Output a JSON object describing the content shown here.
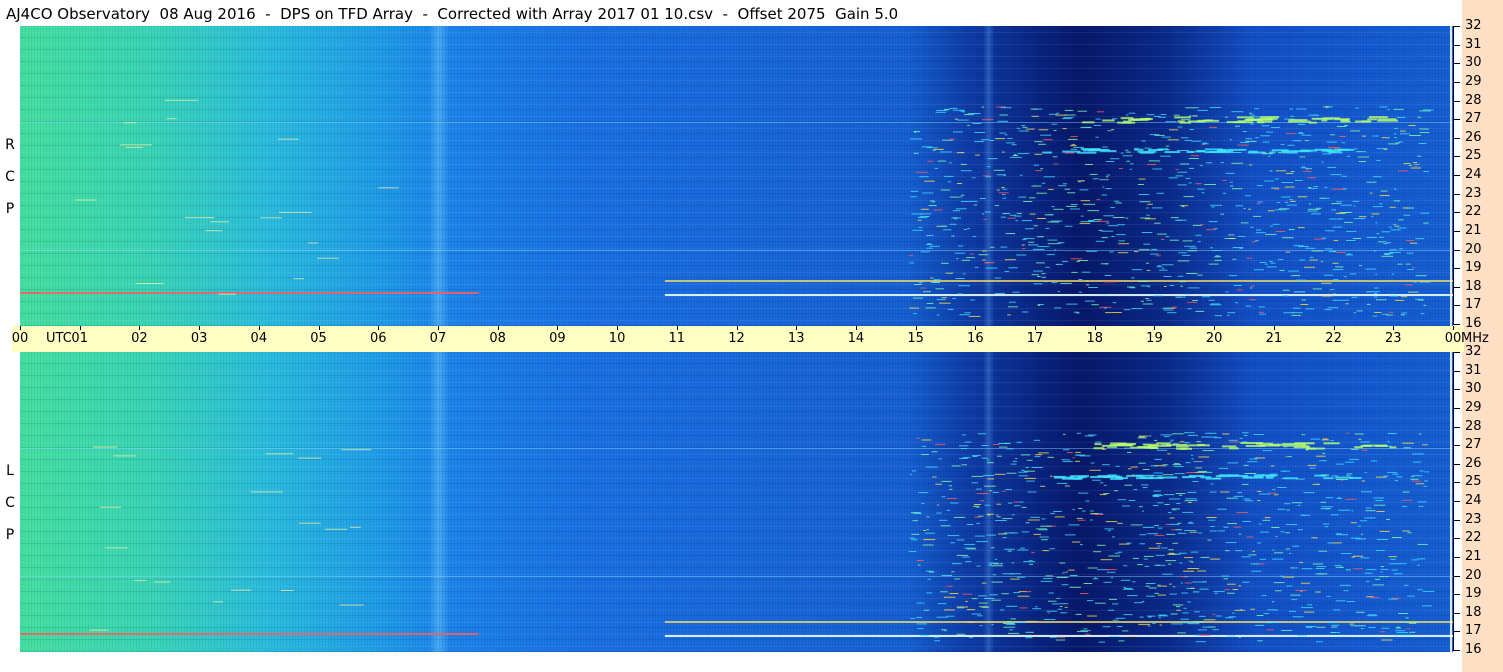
{
  "title": "AJ4CO Observatory  08 Aug 2016  -  DPS on TFD Array  -  Corrected with Array 2017 01 10.csv  -  Offset 2075  Gain 5.0",
  "panels": {
    "rcp": {
      "label": [
        "R",
        "C",
        "P"
      ]
    },
    "lcp": {
      "label": [
        "L",
        "C",
        "P"
      ]
    }
  },
  "time_axis": {
    "labels": [
      "00",
      "01",
      "02",
      "03",
      "04",
      "05",
      "06",
      "07",
      "08",
      "09",
      "10",
      "11",
      "12",
      "13",
      "14",
      "15",
      "16",
      "17",
      "18",
      "19",
      "20",
      "21",
      "22",
      "23",
      "00"
    ],
    "utc_label": "UTC",
    "mhz_label": "MHz"
  },
  "colors": {
    "background": "#ffffff",
    "time_axis_bg": "#ffffc4",
    "right_strip_bg": "#ffe0c4"
  },
  "chart_data": [
    {
      "type": "heatmap",
      "title": "AJ4CO Observatory  08 Aug 2016  -  DPS on TFD Array  -  Corrected with Array 2017 01 10.csv  -  Offset 2075  Gain 5.0",
      "panel": "RCP",
      "xlabel": "UTC",
      "ylabel": "MHz",
      "x_ticks": [
        "00",
        "01",
        "02",
        "03",
        "04",
        "05",
        "06",
        "07",
        "08",
        "09",
        "10",
        "11",
        "12",
        "13",
        "14",
        "15",
        "16",
        "17",
        "18",
        "19",
        "20",
        "21",
        "22",
        "23",
        "00"
      ],
      "y_ticks": [
        32,
        31,
        30,
        29,
        28,
        27,
        26,
        25,
        24,
        23,
        22,
        21,
        20,
        19,
        18,
        17,
        16
      ],
      "xlim": [
        0,
        24
      ],
      "ylim": [
        16,
        32
      ],
      "colormap": [
        "#000020",
        "#06186a",
        "#1560d2",
        "#2bbedd",
        "#45e0a0",
        "#ffff60",
        "#ff4040",
        "#ffffff"
      ]
    },
    {
      "type": "heatmap",
      "panel": "LCP",
      "xlabel": "UTC",
      "ylabel": "MHz",
      "x_ticks": [
        "00",
        "01",
        "02",
        "03",
        "04",
        "05",
        "06",
        "07",
        "08",
        "09",
        "10",
        "11",
        "12",
        "13",
        "14",
        "15",
        "16",
        "17",
        "18",
        "19",
        "20",
        "21",
        "22",
        "23",
        "00"
      ],
      "y_ticks": [
        32,
        31,
        30,
        29,
        28,
        27,
        26,
        25,
        24,
        23,
        22,
        21,
        20,
        19,
        18,
        17,
        16
      ],
      "xlim": [
        0,
        24
      ],
      "ylim": [
        16,
        32
      ],
      "colormap": [
        "#000020",
        "#06186a",
        "#1560d2",
        "#2bbedd",
        "#45e0a0",
        "#ffff60",
        "#ff4040",
        "#ffffff"
      ]
    }
  ]
}
